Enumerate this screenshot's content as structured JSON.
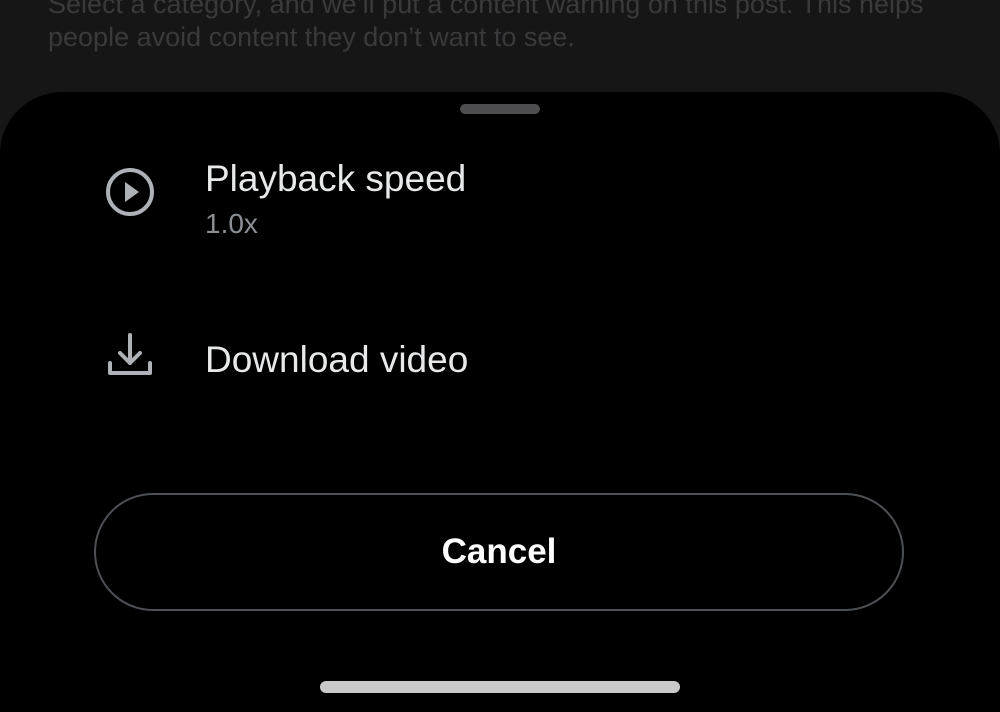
{
  "background": {
    "text": "Select a category, and we’ll put a content warning on this post. This helps people avoid content they don’t want to see."
  },
  "sheet": {
    "items": [
      {
        "icon": "play-circle-icon",
        "label": "Playback speed",
        "value": "1.0x"
      },
      {
        "icon": "download-icon",
        "label": "Download video"
      }
    ],
    "cancel_label": "Cancel"
  },
  "colors": {
    "sheet_background": "#000000",
    "primary_text": "#e7e9ea",
    "secondary_text": "#8b8f94",
    "button_border": "#4c4f53"
  }
}
